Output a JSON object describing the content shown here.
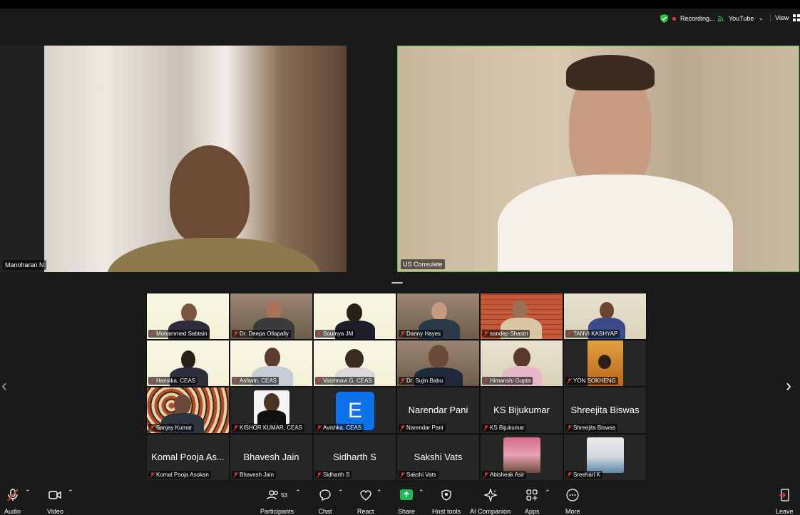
{
  "top": {
    "recording": "Recording...",
    "youtube": "YouTube",
    "view": "View"
  },
  "speakers": [
    {
      "name": "Manoharan N"
    },
    {
      "name": "US Consulate"
    }
  ],
  "gallery": [
    {
      "label": "Mohammed Sabtain",
      "big": ""
    },
    {
      "label": "Dr. Deepa Ollapally",
      "big": ""
    },
    {
      "label": "Soumya JM",
      "big": ""
    },
    {
      "label": "Danny Hayes",
      "big": ""
    },
    {
      "label": "sandep Shastri",
      "big": ""
    },
    {
      "label": "TANVI KASHYAP",
      "big": ""
    },
    {
      "label": "Hansika, CEAS",
      "big": ""
    },
    {
      "label": "Ashwin, CEAS",
      "big": ""
    },
    {
      "label": "Vaishnavi G, CEAS",
      "big": ""
    },
    {
      "label": "Dr. Sujin Babu",
      "big": ""
    },
    {
      "label": "Himanshi Gupta",
      "big": ""
    },
    {
      "label": "YON SOKHENG",
      "big": ""
    },
    {
      "label": "Sanjay Kumar",
      "big": ""
    },
    {
      "label": "KISHOR KUMAR, CEAS",
      "big": ""
    },
    {
      "label": "Avishka, CEAS",
      "big": "",
      "avatar": "E"
    },
    {
      "label": "Narendar Pani",
      "big": "Narendar Pani"
    },
    {
      "label": "KS Bijukumar",
      "big": "KS Bijukumar"
    },
    {
      "label": "Shreejita Biswas",
      "big": "Shreejita Biswas"
    },
    {
      "label": "Komal Pooja Asokan",
      "big": "Komal Pooja As..."
    },
    {
      "label": "Bhavesh Jain",
      "big": "Bhavesh Jain"
    },
    {
      "label": "Sidharth S",
      "big": "Sidharth S"
    },
    {
      "label": "Sakshi Vats",
      "big": "Sakshi Vats"
    },
    {
      "label": "Abisheak Asir",
      "big": ""
    },
    {
      "label": "Sreehari K",
      "big": ""
    }
  ],
  "toolbar": {
    "audio": "Audio",
    "video": "Video",
    "participants": "Participants",
    "participants_count": "53",
    "chat": "Chat",
    "react": "React",
    "share": "Share",
    "host_tools": "Host tools",
    "ai_companion": "AI Companion",
    "apps": "Apps",
    "more": "More",
    "leave": "Leave"
  },
  "colors": {
    "active_speaker_border": "#4cc24c",
    "share_green": "#1db954",
    "recording_red": "#e5383b",
    "muted_red": "#e5383b",
    "avatar_blue": "#0e72ed"
  }
}
